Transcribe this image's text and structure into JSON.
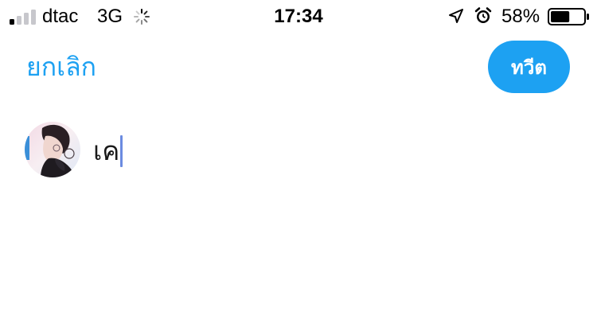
{
  "status_bar": {
    "carrier": "dtac",
    "network": "3G",
    "time": "17:34",
    "battery_percent": "58%",
    "battery_level": 0.58,
    "signal_bars_filled": 1,
    "signal_bars_total": 4,
    "icons": [
      "signal-icon",
      "loading-spinner-icon",
      "location-arrow-icon",
      "alarm-clock-icon",
      "battery-icon"
    ]
  },
  "header": {
    "cancel_label": "ยกเลิก",
    "tweet_label": "ทวีต"
  },
  "compose": {
    "text": "เค"
  },
  "colors": {
    "accent": "#1da1f2",
    "caret": "#6b8be0"
  }
}
